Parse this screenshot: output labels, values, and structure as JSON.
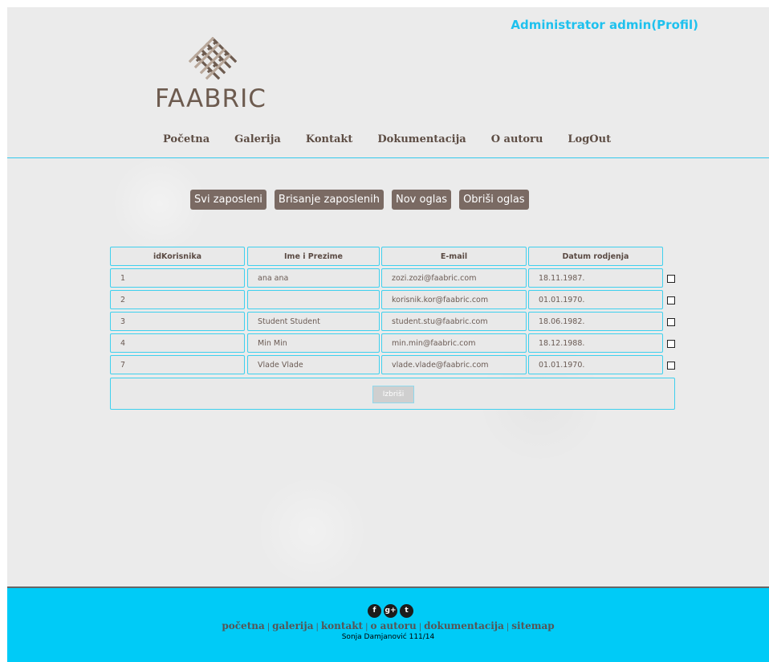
{
  "header": {
    "admin_link": "Administrator admin(Profil)",
    "logo_text": "FAABRIC"
  },
  "nav": {
    "items": [
      "Početna",
      "Galerija",
      "Kontakt",
      "Dokumentacija",
      "O autoru",
      "LogOut"
    ]
  },
  "actions": {
    "all_employees": "Svi zaposleni",
    "delete_employees": "Brisanje zaposlenih",
    "new_ad": "Nov oglas",
    "delete_ad": "Obriši oglas"
  },
  "table": {
    "columns": [
      "idKorisnika",
      "Ime i Prezime",
      "E-mail",
      "Datum rodjenja"
    ],
    "rows": [
      {
        "id": "1",
        "name": "ana ana",
        "email": "zozi.zozi@faabric.com",
        "dob": "18.11.1987."
      },
      {
        "id": "2",
        "name": "",
        "email": "korisnik.kor@faabric.com",
        "dob": "01.01.1970."
      },
      {
        "id": "3",
        "name": "Student Student",
        "email": "student.stu@faabric.com",
        "dob": "18.06.1982."
      },
      {
        "id": "4",
        "name": "Min Min",
        "email": "min.min@faabric.com",
        "dob": "18.12.1988."
      },
      {
        "id": "7",
        "name": "Vlade Vlade",
        "email": "vlade.vlade@faabric.com",
        "dob": "01.01.1970."
      }
    ],
    "delete_button": "Izbriši"
  },
  "footer": {
    "social": [
      {
        "icon": "facebook-icon",
        "glyph": "f"
      },
      {
        "icon": "google-plus-icon",
        "glyph": "g+"
      },
      {
        "icon": "twitter-icon",
        "glyph": "t"
      }
    ],
    "links": [
      "početna",
      "galerija",
      "kontakt",
      "o autoru",
      "dokumentacija",
      "sitemap"
    ],
    "credit": "Sonja Damjanović 111/14"
  },
  "colors": {
    "accent": "#1fc1ee",
    "button": "#7a6a63",
    "footer": "#00cbf7",
    "text_brown": "#5d4d44"
  }
}
